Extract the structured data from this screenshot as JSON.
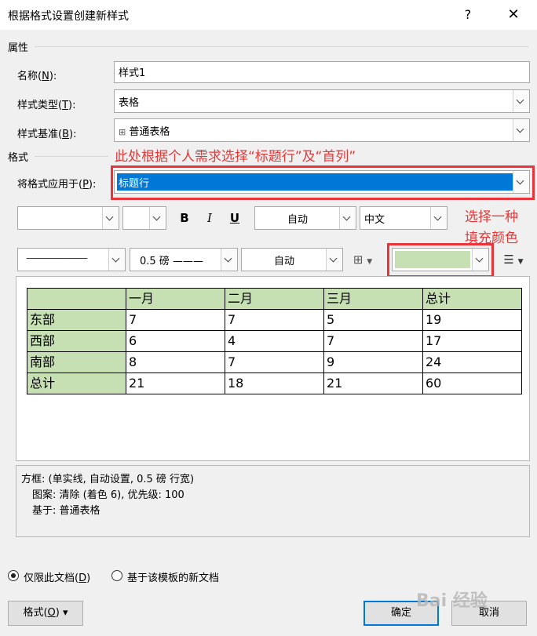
{
  "window": {
    "title": "根据格式设置创建新样式",
    "help": "?",
    "close": "✕"
  },
  "properties": {
    "section_label": "属性",
    "name_label": "名称(",
    "name_key": "N",
    "name_suffix": "):",
    "name_value": "样式1",
    "type_label": "样式类型(",
    "type_key": "T",
    "type_suffix": "):",
    "type_value": "表格",
    "base_label": "样式基准(",
    "base_key": "B",
    "base_suffix": "):",
    "base_icon": "⊞",
    "base_value": "普通表格"
  },
  "format": {
    "section_label": "格式",
    "apply_label": "将格式应用于(",
    "apply_key": "P",
    "apply_suffix": "):",
    "apply_value": "标题行"
  },
  "annotations": {
    "note_top": "此处根据个人需求选择“标题行”及“首列”",
    "note_right_1": "选择一种",
    "note_right_2": "填充颜色"
  },
  "toolbar1": {
    "font_value": "",
    "size_value": "",
    "bold": "B",
    "italic": "I",
    "underline": "U",
    "color_value": "自动",
    "lang_value": "中文"
  },
  "toolbar2": {
    "border_style": "———————",
    "border_width": "0.5 磅 ———",
    "border_color": "自动",
    "borders_icon": "⊞",
    "fill_color": "#c6e0b4",
    "align_icon": "☰"
  },
  "preview_table": {
    "header": [
      "",
      "一月",
      "二月",
      "三月",
      "总计"
    ],
    "rows": [
      [
        "东部",
        "7",
        "7",
        "5",
        "19"
      ],
      [
        "西部",
        "6",
        "4",
        "7",
        "17"
      ],
      [
        "南部",
        "8",
        "7",
        "9",
        "24"
      ],
      [
        "总计",
        "21",
        "18",
        "21",
        "60"
      ]
    ]
  },
  "description": {
    "line1": "方框: (单实线, 自动设置, 0.5 磅 行宽)",
    "line2": "图案: 清除 (着色 6), 优先级: 100",
    "line3": "基于: 普通表格"
  },
  "options": {
    "only_doc_label": "仅限此文档(",
    "only_doc_key": "D",
    "only_doc_suffix": ")",
    "template_label": "基于该模板的新文档"
  },
  "buttons": {
    "format_label": "格式(",
    "format_key": "O",
    "format_suffix": ") ▾",
    "ok_label": "确定",
    "cancel_label": "取消"
  },
  "watermark": "Bai 经验"
}
